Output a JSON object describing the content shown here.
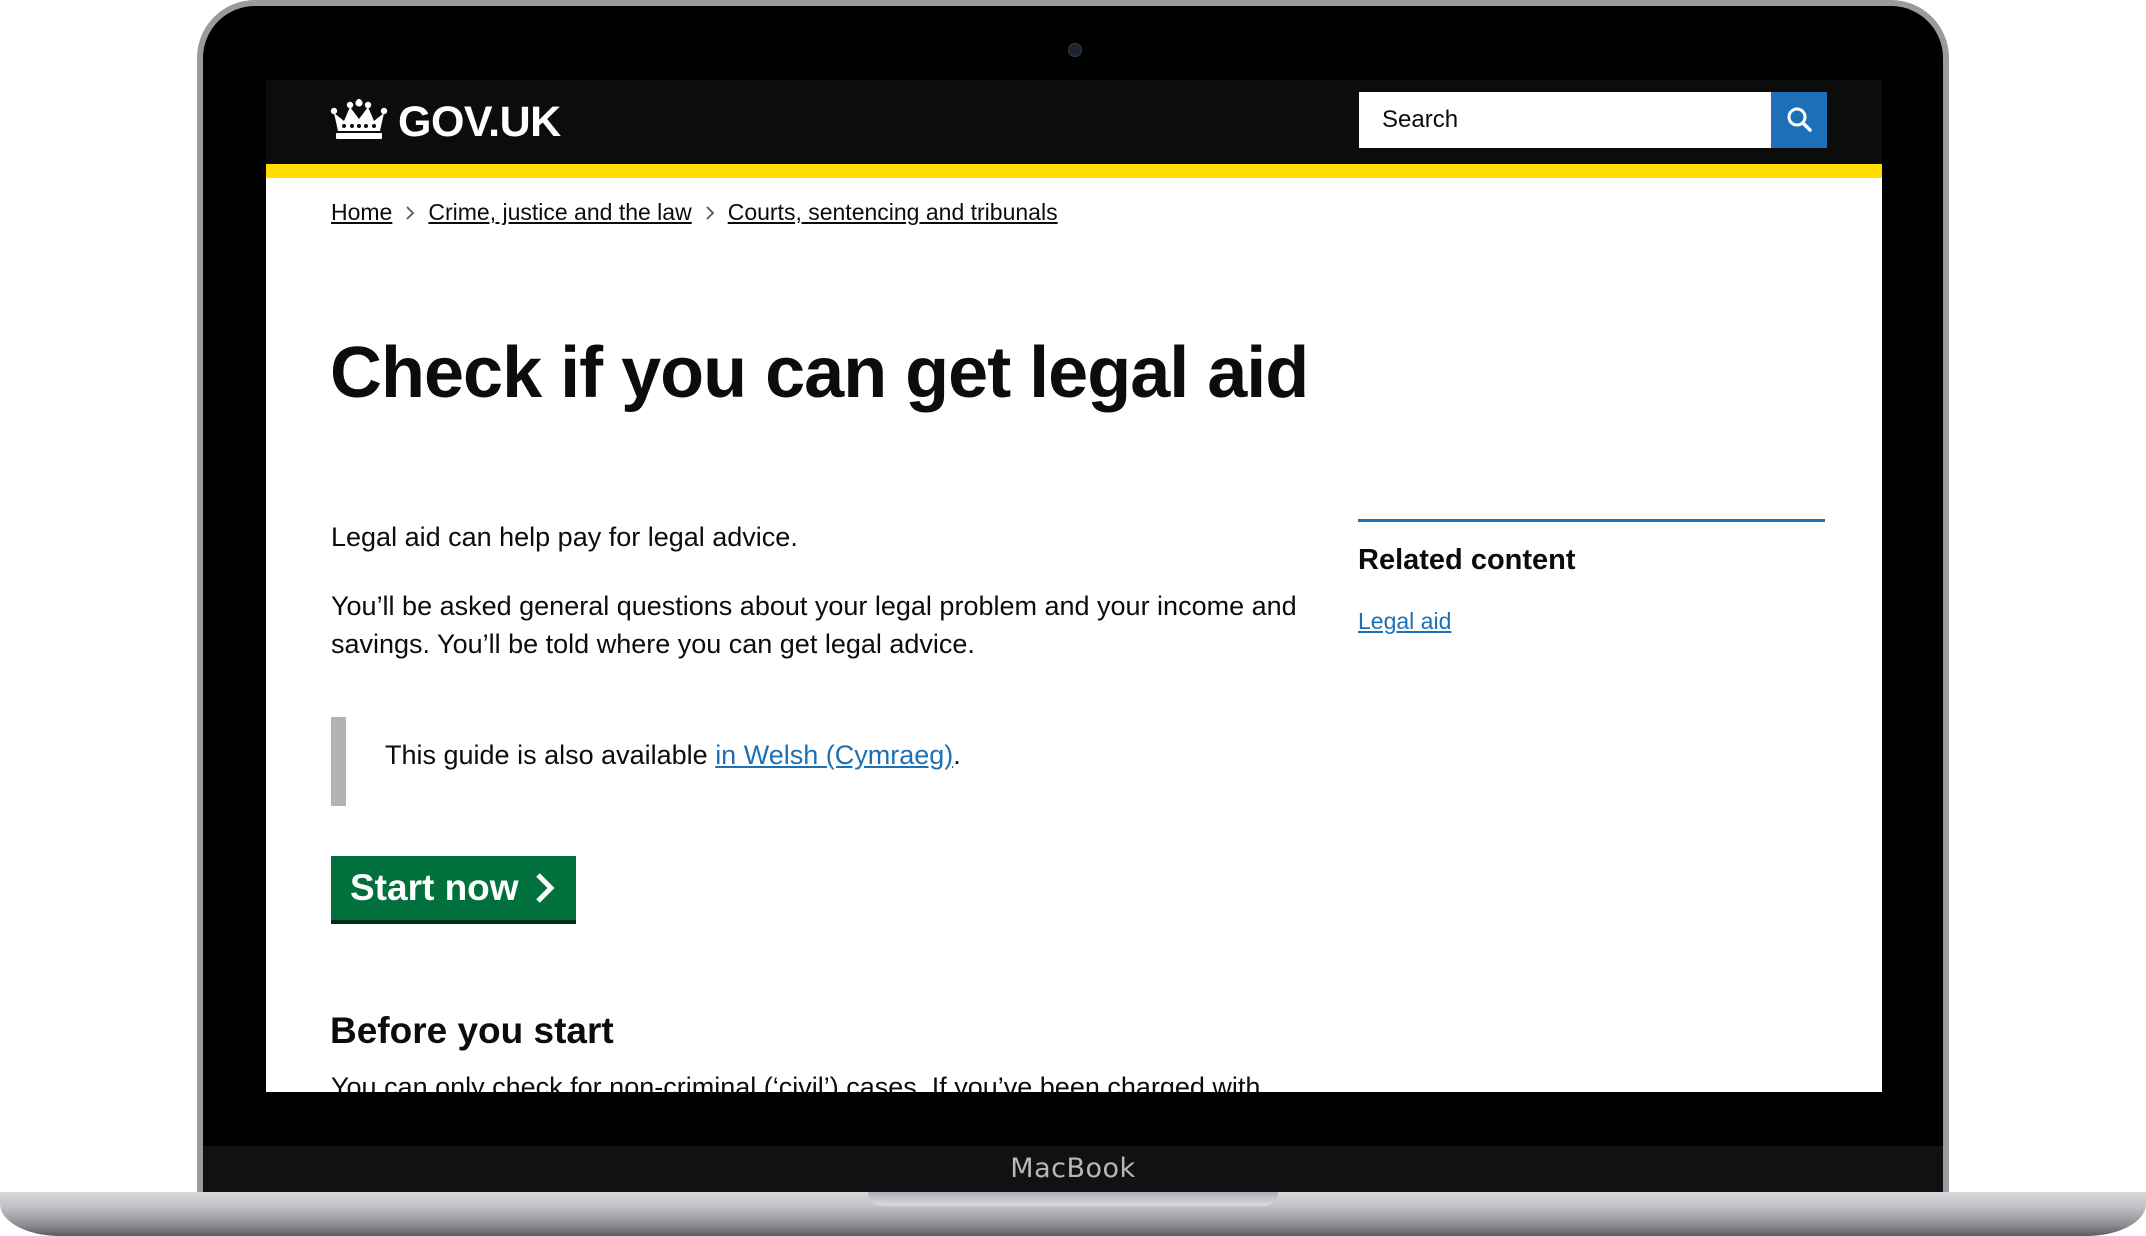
{
  "device": {
    "label": "MacBook"
  },
  "header": {
    "logo_text": "GOV.UK",
    "search": {
      "placeholder": "Search"
    }
  },
  "breadcrumb": {
    "items": [
      "Home",
      "Crime, justice and the law",
      "Courts, sentencing and tribunals"
    ]
  },
  "main": {
    "title": "Check if you can get legal aid",
    "paragraphs": [
      "Legal aid can help pay for legal advice.",
      "You’ll be asked general questions about your legal problem and your income and savings. You’ll be told where you can get legal advice."
    ],
    "inset": {
      "text_before": "This guide is also available ",
      "link": "in Welsh (Cymraeg)",
      "text_after": "."
    },
    "start_button": "Start now",
    "section_heading": "Before you start",
    "cutoff_text": "You can only check for non-criminal (‘civil’) cases. If you’ve been charged with"
  },
  "sidebar": {
    "heading": "Related content",
    "links": [
      "Legal aid"
    ]
  },
  "colors": {
    "header_bg": "#0b0c0c",
    "accent_yellow": "#ffdd00",
    "link_blue": "#1d70b8",
    "button_green": "#00703c",
    "inset_border": "#b1b4b6"
  },
  "icons": {
    "logo": "crown-icon",
    "search": "search-icon",
    "breadcrumb_separator": "chevron-right-icon",
    "start_button": "chevron-right-icon"
  }
}
